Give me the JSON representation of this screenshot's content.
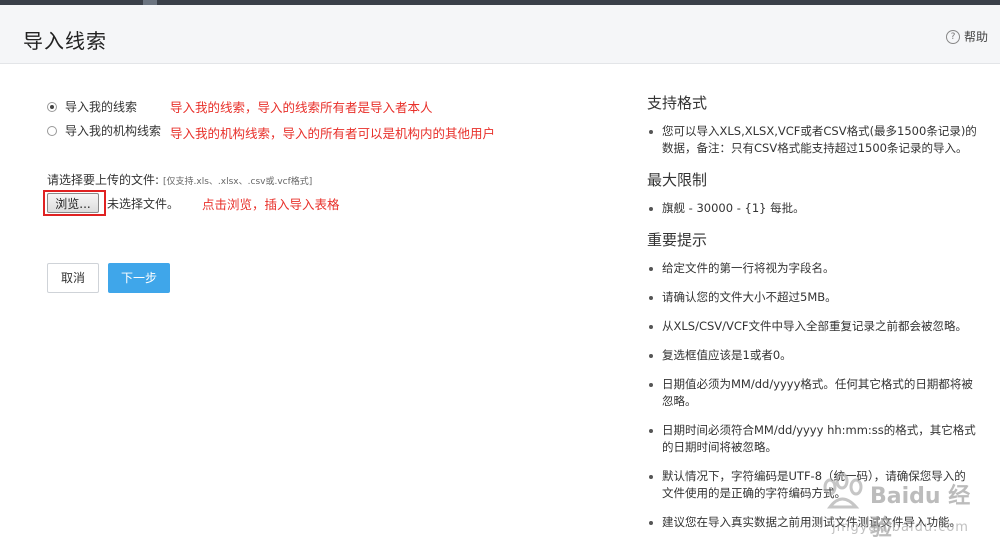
{
  "header": {
    "title": "导入线索",
    "help_label": "帮助"
  },
  "import_options": [
    {
      "label": "导入我的线索",
      "selected": true,
      "annotation": "导入我的线索，导入的线索所有者是导入者本人"
    },
    {
      "label": "导入我的机构线索",
      "selected": false,
      "annotation": "导入我的机构线索，导入的所有者可以是机构内的其他用户"
    }
  ],
  "upload": {
    "label": "请选择要上传的文件:",
    "hint": "[仅支持.xls、.xlsx、.csv或.vcf格式]",
    "browse_label": "浏览...",
    "no_file_text": "未选择文件。",
    "annotation": "点击浏览，插入导入表格"
  },
  "actions": {
    "cancel_label": "取消",
    "next_label": "下一步"
  },
  "sidebar": {
    "formats_title": "支持格式",
    "formats_items": [
      "您可以导入XLS,XLSX,VCF或者CSV格式(最多1500条记录)的数据，备注：只有CSV格式能支持超过1500条记录的导入。"
    ],
    "limit_title": "最大限制",
    "limit_items": [
      "旗舰 - 30000 - {1} 每批。"
    ],
    "notes_title": "重要提示",
    "notes_items": [
      "给定文件的第一行将视为字段名。",
      "请确认您的文件大小不超过5MB。",
      "从XLS/CSV/VCF文件中导入全部重复记录之前都会被忽略。",
      "复选框值应该是1或者0。",
      "日期值必须为MM/dd/yyyy格式。任何其它格式的日期都将被忽略。",
      "日期时间必须符合MM/dd/yyyy hh:mm:ss的格式，其它格式的日期时间将被忽略。",
      "默认情况下，字符编码是UTF-8（统一码），请确保您导入的文件使用的是正确的字符编码方式。",
      "建议您在导入真实数据之前用测试文件测试文件导入功能。"
    ]
  },
  "watermark": {
    "text": "Baidu 经验",
    "url": "jingyan.baidu.com"
  }
}
